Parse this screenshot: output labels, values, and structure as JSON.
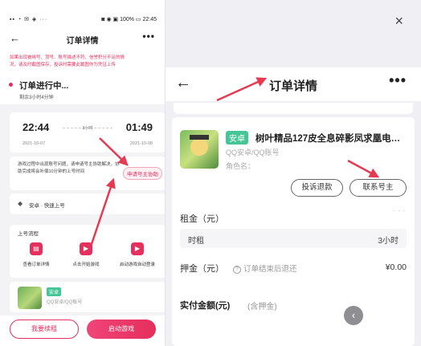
{
  "left": {
    "status_bar": {
      "signal": "▪▪ ◔ ✉ ◈ ···",
      "right": "◙ ◉ ▣ 100% ▭ 22:45"
    },
    "nav": {
      "title": "订单详情",
      "back": "←",
      "more": "•••"
    },
    "warning_lines": [
      "如果出现被绑号、顶号、账号描述不符、信誉积分不足的情",
      "况，请及时截图保存，投诉时需要此截图作为凭证上传"
    ],
    "status": {
      "title": "订单进行中...",
      "remaining": "剩余3小时4分钟"
    },
    "time": {
      "start_time": "22:44",
      "end_time": "01:49",
      "duration": "3小时",
      "start_date": "2021-10-07",
      "end_date": "2021-10-08"
    },
    "help": {
      "text": "游戏过程中出现账号问题，请申请号主协助解决，协助完成将会补偿10分钟的上号时间",
      "button": "申请号主协助"
    },
    "platform": {
      "text": "安卓 · 快速上号"
    },
    "flow": {
      "title": "上号流程",
      "steps": [
        {
          "label": "查看订单详情",
          "icon": "▤"
        },
        {
          "label": "点击开始游戏",
          "icon": "▶"
        },
        {
          "label": "启动游戏自动登录",
          "icon": "▶"
        }
      ]
    },
    "game": {
      "badge": "安卓",
      "account_type": "QQ安卓/QQ账号"
    },
    "buttons": {
      "renew": "我要续租",
      "start": "启动游戏"
    }
  },
  "right": {
    "close": "×",
    "nav": {
      "title": "订单详情",
      "back": "←",
      "more": "•••"
    },
    "game": {
      "badge": "安卓",
      "title": "树叶精品127皮全息碎影凤求凰电…",
      "account_type": "QQ安卓/QQ账号",
      "role": "角色名："
    },
    "buttons": {
      "refund": "投诉退款",
      "contact": "联系号主"
    },
    "rent": {
      "label": "租金（元）",
      "dots": "· · ·",
      "row_key": "时租",
      "row_value": "3小时"
    },
    "deposit": {
      "label": "押金（元）",
      "note": "订单结束后退还",
      "value": "¥0.00"
    },
    "payment": {
      "label": "实付金额(元)",
      "note": "(含押金)"
    },
    "float_button": "‹"
  },
  "colors": {
    "accent": "#e52f5d",
    "badge": "#46c596",
    "annotation_arrow": "#e53a52"
  }
}
